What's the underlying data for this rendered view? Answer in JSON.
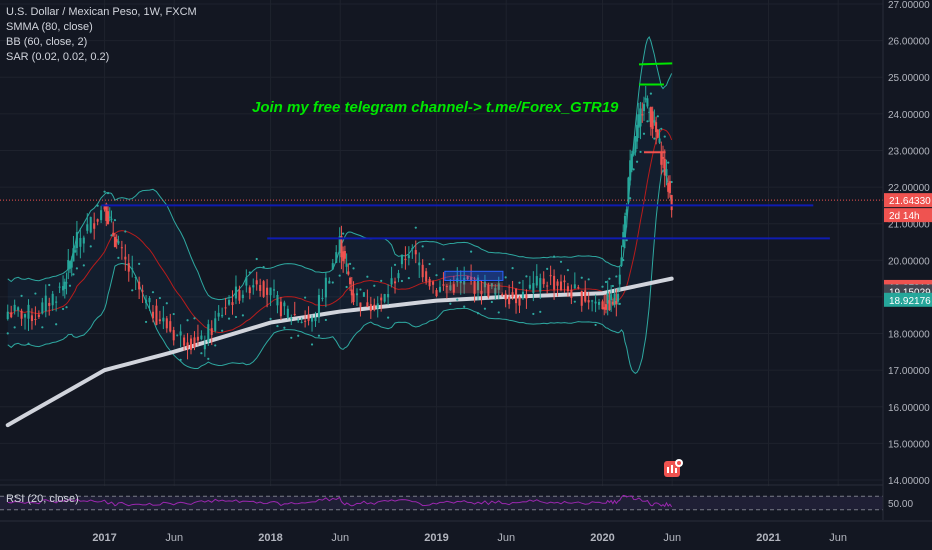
{
  "header": {
    "symbol_line": "U.S. Dollar / Mexican Peso, 1W, FXCM",
    "indicators": [
      "SMMA (80, close)",
      "BB (60, close, 2)",
      "SAR (0.02, 0.02, 0.2)"
    ]
  },
  "annotation": {
    "text": "Join my free telegram channel-> t.me/Forex_GTR19",
    "color": "#00e600"
  },
  "rsi": {
    "label": "RSI (20, close)",
    "tick": "50.00"
  },
  "colors": {
    "background": "#131722",
    "up": "#26a69a",
    "down": "#ef5350",
    "smma": "#d1d4dc",
    "bb": "#2ea8a0",
    "sar": "#2ea8a0",
    "support": "#0f1cb0",
    "rsi": "#9c27b0"
  },
  "chart_data": {
    "type": "candlestick",
    "symbol": "USD/MXN",
    "timeframe": "1W",
    "source": "FXCM",
    "x_axis": {
      "ticks": [
        "2017",
        "Jun",
        "2018",
        "Jun",
        "2019",
        "Jun",
        "2020",
        "Jun",
        "2021",
        "Jun"
      ]
    },
    "y_axis": {
      "range": [
        14.0,
        27.0
      ],
      "ticks": [
        "27.00000",
        "26.00000",
        "25.00000",
        "24.00000",
        "23.00000",
        "22.00000",
        "21.00000",
        "20.00000",
        "19.00000",
        "18.00000",
        "17.00000",
        "16.00000",
        "15.00000",
        "14.00000"
      ]
    },
    "price_labels": [
      {
        "value": 21.6433,
        "text": "21.64330",
        "color": "#ef5350"
      },
      {
        "value": null,
        "text": "2d 14h",
        "color": "#ef5350"
      },
      {
        "value": 19.27316,
        "text": "19.27316",
        "color": "#ef5350"
      },
      {
        "value": 19.15029,
        "text": "19.15029",
        "color": "#434651"
      },
      {
        "value": 18.92176,
        "text": "18.92176",
        "color": "#26a69a"
      }
    ],
    "series": [
      {
        "name": "USD/MXN",
        "points": [
          [
            "2016-06",
            18.6
          ],
          [
            "2016-08",
            18.5
          ],
          [
            "2016-10",
            19.3
          ],
          [
            "2016-11",
            20.5
          ],
          [
            "2017-01",
            21.5
          ],
          [
            "2017-02",
            20.3
          ],
          [
            "2017-04",
            18.8
          ],
          [
            "2017-06",
            18.0
          ],
          [
            "2017-08",
            17.7
          ],
          [
            "2017-10",
            18.9
          ],
          [
            "2017-12",
            19.5
          ],
          [
            "2018-02",
            18.6
          ],
          [
            "2018-04",
            18.3
          ],
          [
            "2018-06",
            20.5
          ],
          [
            "2018-07",
            19.0
          ],
          [
            "2018-09",
            18.8
          ],
          [
            "2018-11",
            20.3
          ],
          [
            "2019-01",
            19.2
          ],
          [
            "2019-03",
            19.4
          ],
          [
            "2019-05",
            19.2
          ],
          [
            "2019-07",
            19.0
          ],
          [
            "2019-09",
            19.5
          ],
          [
            "2019-11",
            19.1
          ],
          [
            "2020-01",
            18.8
          ],
          [
            "2020-02",
            18.9
          ],
          [
            "2020-03",
            22.5
          ],
          [
            "2020-04",
            24.5
          ],
          [
            "2020-05",
            23.3
          ],
          [
            "2020-06",
            21.6
          ]
        ]
      },
      {
        "name": "SMMA (80, close)",
        "points": [
          [
            "2016-06",
            15.5
          ],
          [
            "2017-01",
            17.0
          ],
          [
            "2017-06",
            17.5
          ],
          [
            "2018-01",
            18.3
          ],
          [
            "2018-06",
            18.6
          ],
          [
            "2019-01",
            18.9
          ],
          [
            "2019-06",
            19.0
          ],
          [
            "2020-01",
            19.1
          ],
          [
            "2020-06",
            19.5
          ]
        ]
      }
    ],
    "horizontal_levels": [
      21.5,
      20.6
    ],
    "rsi_level": 50
  }
}
